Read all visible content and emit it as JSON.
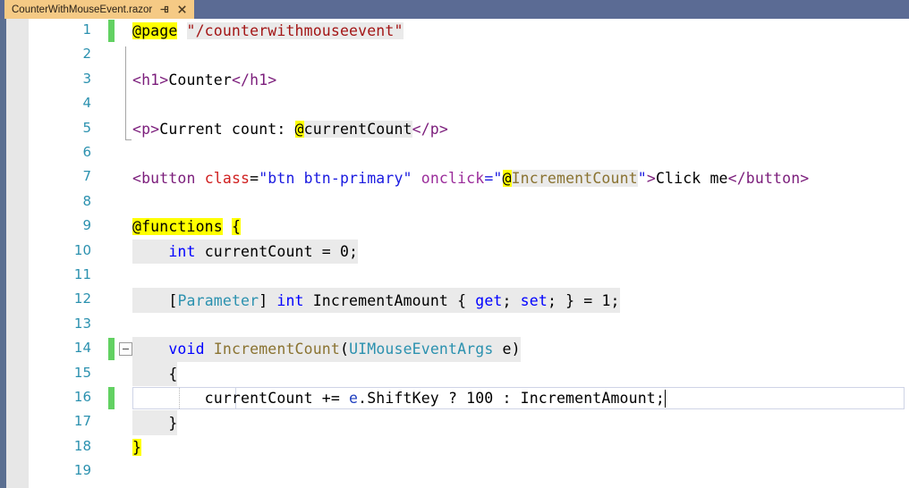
{
  "window": {
    "tab": {
      "title": "CounterWithMouseEvent.razor",
      "pin_icon": "pin-icon",
      "close_icon": "close-icon",
      "close_label": "×"
    },
    "tabbar_color": "#5b6b94",
    "active_tab_color": "#f5ca85"
  },
  "editor": {
    "language": "razor",
    "caret_line": 16,
    "line_numbers": [
      1,
      2,
      3,
      4,
      5,
      6,
      7,
      8,
      9,
      10,
      11,
      12,
      13,
      14,
      15,
      16,
      17,
      18,
      19
    ],
    "change_bar_lines": [
      1,
      14,
      16
    ],
    "collapse_line": 14,
    "lines": [
      {
        "n": 1,
        "text": "@page \"/counterwithmouseevent\""
      },
      {
        "n": 2,
        "text": ""
      },
      {
        "n": 3,
        "text": "<h1>Counter</h1>"
      },
      {
        "n": 4,
        "text": ""
      },
      {
        "n": 5,
        "text": "<p>Current count: @currentCount</p>"
      },
      {
        "n": 6,
        "text": ""
      },
      {
        "n": 7,
        "text": "<button class=\"btn btn-primary\" onclick=\"@IncrementCount\">Click me</button>"
      },
      {
        "n": 8,
        "text": ""
      },
      {
        "n": 9,
        "text": "@functions {"
      },
      {
        "n": 10,
        "text": "    int currentCount = 0;"
      },
      {
        "n": 11,
        "text": ""
      },
      {
        "n": 12,
        "text": "    [Parameter] int IncrementAmount { get; set; } = 1;"
      },
      {
        "n": 13,
        "text": ""
      },
      {
        "n": 14,
        "text": "    void IncrementCount(UIMouseEventArgs e)"
      },
      {
        "n": 15,
        "text": "    {"
      },
      {
        "n": 16,
        "text": "        currentCount += e.ShiftKey ? 100 : IncrementAmount;"
      },
      {
        "n": 17,
        "text": "    }"
      },
      {
        "n": 18,
        "text": "}"
      },
      {
        "n": 19,
        "text": ""
      }
    ],
    "tokens": {
      "l1": {
        "a": "@page",
        "b": " ",
        "c": "\"/counterwithmouseevent\""
      },
      "l3": {
        "a": "<h1>",
        "b": "Counter",
        "c": "</h1>"
      },
      "l5": {
        "a": "<p>",
        "b": "Current count: ",
        "c": "@",
        "d": "currentCount",
        "e": "</p>"
      },
      "l7": {
        "a": "<button",
        "b": " ",
        "c": "class",
        "d": "=",
        "e": "\"btn btn-primary\"",
        "f": " ",
        "g": "onclick",
        "h": "=\"",
        "i": "@",
        "j": "IncrementCount",
        "k": "\"",
        "l": ">",
        "m": "Click me",
        "n": "</button>"
      },
      "l9": {
        "a": "@functions",
        "b": " ",
        "c": "{"
      },
      "l10": {
        "a": "int",
        "b": " currentCount = 0;"
      },
      "l12": {
        "a": "[",
        "b": "Parameter",
        "c": "] ",
        "d": "int",
        "e": " IncrementAmount { ",
        "f": "get",
        "g": "; ",
        "h": "set",
        "i": "; } = 1;"
      },
      "l14": {
        "a": "void",
        "b": " ",
        "c": "IncrementCount",
        "d": "(",
        "e": "UIMouseEventArgs",
        "f": " e)"
      },
      "l15": {
        "a": "{"
      },
      "l16": {
        "a": "currentCount += ",
        "b": "e",
        "c": ".ShiftKey ? 100 : IncrementAmount;"
      },
      "l17": {
        "a": "}"
      },
      "l18": {
        "a": "}"
      }
    }
  },
  "colors": {
    "keyword": "#0000ff",
    "type": "#2b91af",
    "method": "#8a7331",
    "string": "#a31515",
    "html_tag": "#7b1d7b",
    "html_attr": "#d02020",
    "attr_value": "#1a1ae0",
    "highlight": "#ffff00",
    "razor_block": "#eaeaea",
    "linenumber": "#2b91af",
    "change_bar": "#62d162"
  }
}
